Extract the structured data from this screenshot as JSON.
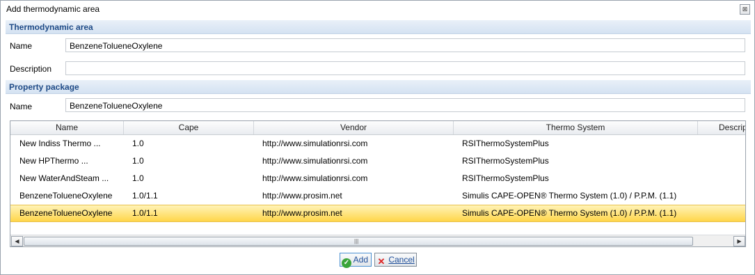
{
  "window": {
    "title": "Add thermodynamic area",
    "close_glyph": "⊠"
  },
  "thermo_area": {
    "header": "Thermodynamic area",
    "name_label": "Name",
    "name_value": "BenzeneTolueneOxylene",
    "description_label": "Description",
    "description_value": ""
  },
  "property_package": {
    "header": "Property package",
    "name_label": "Name",
    "name_value": "BenzeneTolueneOxylene"
  },
  "grid": {
    "columns": [
      "Name",
      "Cape",
      "Vendor",
      "Thermo System",
      "Descrip"
    ],
    "rows": [
      {
        "name": "New Indiss Thermo ...",
        "cape": "1.0",
        "vendor": "http://www.simulationrsi.com",
        "thermo": "RSIThermoSystemPlus",
        "selected": false
      },
      {
        "name": "New HPThermo ...",
        "cape": "1.0",
        "vendor": "http://www.simulationrsi.com",
        "thermo": "RSIThermoSystemPlus",
        "selected": false
      },
      {
        "name": "New WaterAndSteam ...",
        "cape": "1.0",
        "vendor": "http://www.simulationrsi.com",
        "thermo": "RSIThermoSystemPlus",
        "selected": false
      },
      {
        "name": "BenzeneTolueneOxylene",
        "cape": "1.0/1.1",
        "vendor": "http://www.prosim.net",
        "thermo": "Simulis CAPE-OPEN® Thermo System (1.0) / P.P.M. (1.1)",
        "selected": false
      },
      {
        "name": "BenzeneTolueneOxylene",
        "cape": "1.0/1.1",
        "vendor": "http://www.prosim.net",
        "thermo": "Simulis CAPE-OPEN® Thermo System (1.0) / P.P.M. (1.1)",
        "selected": true
      }
    ],
    "scroll_left_glyph": "◀",
    "scroll_right_glyph": "▶",
    "scroll_grip_glyph": "|||"
  },
  "buttons": {
    "add_label": "Add",
    "add_icon": "check-circle-icon",
    "cancel_label": "Cancel",
    "cancel_icon": "x-icon"
  },
  "colors": {
    "section_text": "#1e4a86",
    "selection": "#ffd64a"
  }
}
